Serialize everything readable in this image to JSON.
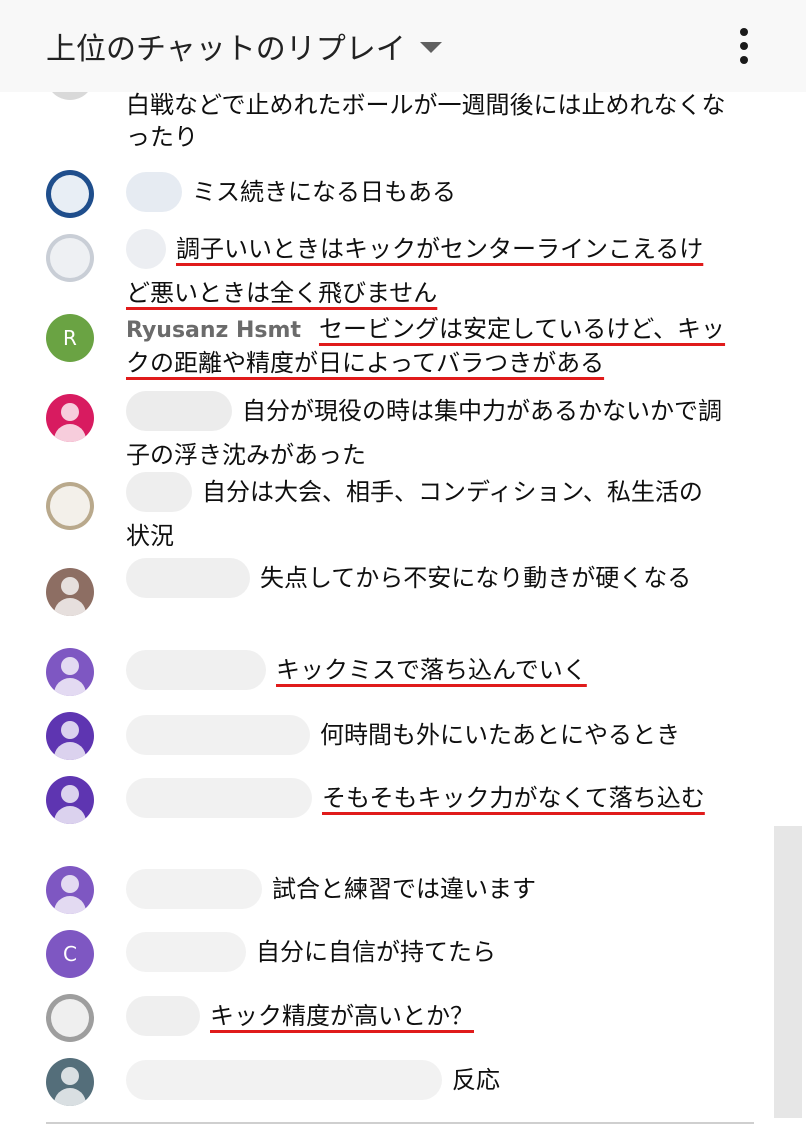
{
  "header": {
    "title": "上位のチャットのリプレイ",
    "dropdown_icon": "triangle-down-icon",
    "menu_icon": "more-vert-icon"
  },
  "messages": [
    {
      "author": "",
      "text": "白戦などで止めれたボールが一週間後には止めれなくなったり",
      "underlined": false
    },
    {
      "author": "",
      "text": "ミス続きになる日もある",
      "underlined": false
    },
    {
      "author": "",
      "text": "調子いいときはキックがセンターラインこえるけど悪いときは全く飛びません",
      "underlined": true
    },
    {
      "author": "Ryusanz Hsmt",
      "avatar_letter": "R",
      "text": "セービングは安定しているけど、キックの距離や精度が日によってバラつきがある",
      "underlined": true
    },
    {
      "author": "",
      "text": "自分が現役の時は集中力があるかないかで調子の浮き沈みがあった",
      "underlined": false
    },
    {
      "author": "",
      "text": "自分は大会、相手、コンディション、私生活の状況",
      "underlined": false
    },
    {
      "author": "",
      "text": "失点してから不安になり動きが硬くなる",
      "underlined": false
    },
    {
      "author": "",
      "text": "キックミスで落ち込んでいく",
      "underlined": true
    },
    {
      "author": "",
      "text": "何時間も外にいたあとにやるとき",
      "underlined": false
    },
    {
      "author": "",
      "text": "そもそもキック力がなくて落ち込む",
      "underlined": true
    },
    {
      "author": "",
      "text": "試合と練習では違います",
      "underlined": false
    },
    {
      "author": "",
      "avatar_letter": "C",
      "text": "自分に自信が持てたら",
      "underlined": false
    },
    {
      "author": "",
      "text": "キック精度が高いとか？",
      "underlined": true
    },
    {
      "author": "",
      "text": "反応",
      "underlined": false
    }
  ],
  "colors": {
    "header_bg": "#f8f8f8",
    "underline": "#e01b1b",
    "avatar_green": "#6aa343",
    "avatar_pink": "#d81b60",
    "avatar_brown": "#8d6e63",
    "avatar_purple": "#7e57c2",
    "avatar_indigo": "#5e35b1",
    "avatar_slate": "#546e7a"
  }
}
